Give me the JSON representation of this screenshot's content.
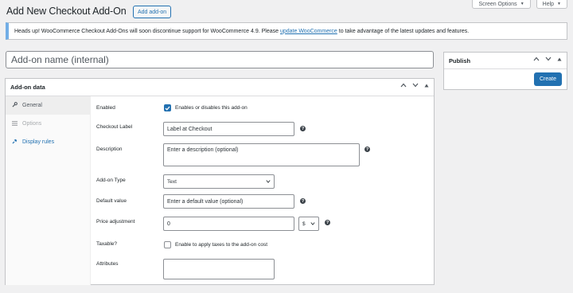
{
  "screen_tabs": [
    {
      "label": "Screen Options"
    },
    {
      "label": "Help"
    }
  ],
  "header": {
    "title": "Add New Checkout Add-On",
    "add_button": "Add add-on"
  },
  "notice": {
    "before": "Heads up! WooCommerce Checkout Add-Ons will soon discontinue support for WooCommerce 4.9. Please ",
    "link": "update WooCommerce",
    "after": " to take advantage of the latest updates and features."
  },
  "name_input": {
    "placeholder": "Add-on name (internal)"
  },
  "publish": {
    "title": "Publish",
    "create_button": "Create"
  },
  "panel": {
    "title": "Add-on data",
    "tabs": [
      {
        "label": "General",
        "icon": "wrench-icon",
        "state": "active"
      },
      {
        "label": "Options",
        "icon": "list-icon",
        "state": "disabled"
      },
      {
        "label": "Display rules",
        "icon": "pin-icon",
        "state": "normal"
      }
    ],
    "fields": {
      "enabled_label": "Enabled",
      "enabled_text": "Enables or disables this add-on",
      "enabled_checked": true,
      "checkout_label_label": "Checkout Label",
      "checkout_label_value": "Label at Checkout",
      "description_label": "Description",
      "description_placeholder": "Enter a description (optional)",
      "type_label": "Add-on Type",
      "type_value": "Text",
      "default_label": "Default value",
      "default_placeholder": "Enter a default value (optional)",
      "price_label": "Price adjustment",
      "price_value": "0",
      "price_unit": "$",
      "taxable_label": "Taxable?",
      "taxable_text": "Enable to apply taxes to the add-on cost",
      "taxable_checked": false,
      "attributes_label": "Attributes"
    }
  },
  "colors": {
    "accent": "#2271b1",
    "notice_border": "#72aee6",
    "background": "#f0f0f1"
  }
}
